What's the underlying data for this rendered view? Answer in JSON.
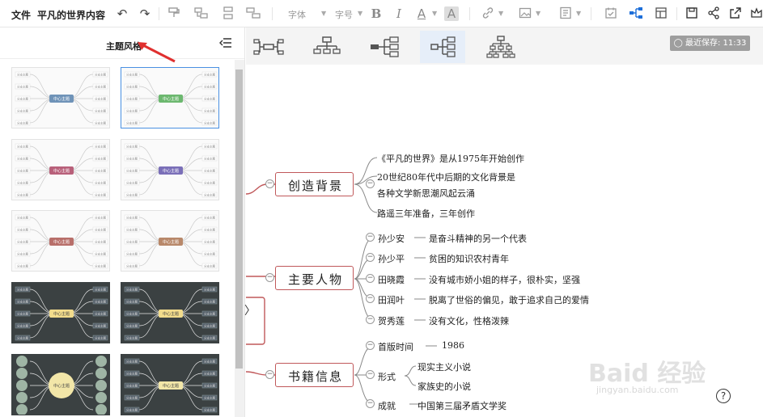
{
  "toolbar": {
    "file_label": "文件",
    "doc_title": "平凡的世界内容",
    "font_label": "字体",
    "size_label": "字号",
    "bold": "B",
    "italic": "I",
    "color_letter": "A",
    "highlight_letter": "A"
  },
  "sidebar": {
    "title": "主题风格",
    "collapse_icon": "collapse-left-icon"
  },
  "save_status": "最近保存: 11:33",
  "mindmap": {
    "topics": [
      {
        "label": "创造背景",
        "children": [
          "《平凡的世界》是从1975年开始创作",
          "20世纪80年代中后期的文化背景是",
          "各种文学新思潮风起云涌",
          "路遥三年准备，三年创作"
        ]
      },
      {
        "label": "主要人物",
        "children": [
          {
            "name": "孙少安",
            "desc": "是奋斗精神的另一个代表"
          },
          {
            "name": "孙少平",
            "desc": "贫困的知识农村青年"
          },
          {
            "name": "田晓霞",
            "desc": "没有城市娇小姐的样子，很朴实，坚强"
          },
          {
            "name": "田润叶",
            "desc": "脱离了世俗的偏见，敢于追求自己的爱情"
          },
          {
            "name": "贺秀莲",
            "desc": "没有文化，性格泼辣"
          }
        ]
      },
      {
        "label": "书籍信息",
        "children": [
          {
            "name": "首版时间",
            "desc": "1986"
          },
          {
            "name": "形式",
            "subs": [
              "现实主义小说",
              "家族史的小说"
            ]
          },
          {
            "name": "成就",
            "desc": "中国第三届矛盾文学奖"
          }
        ]
      }
    ]
  },
  "theme_previews": {
    "center_label": "中心主题",
    "branch_label": "分支主题"
  },
  "help_label": "?",
  "watermark": {
    "main": "Baid 经验",
    "sub": "jingyan.baidu.com"
  },
  "colors": {
    "accent": "#1e6fd9",
    "node_border": "#c0585a",
    "arrow": "#e0302f"
  }
}
